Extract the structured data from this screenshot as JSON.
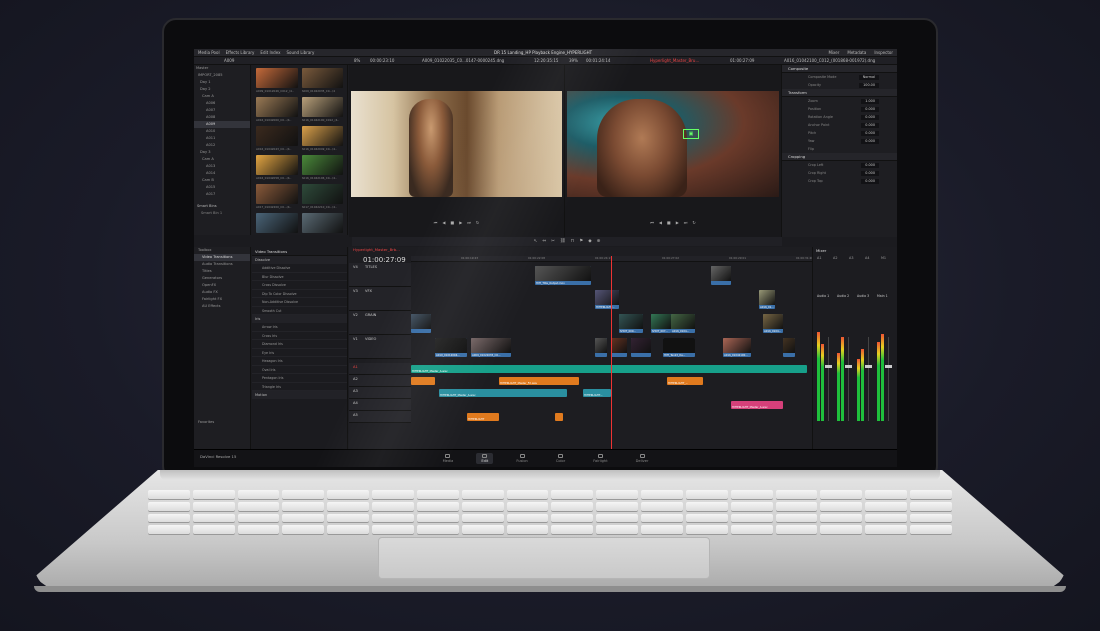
{
  "app": {
    "title": "DR 15 Landing_HP Playback Engine_HYPERLIGHT",
    "brand": "DaVinci Resolve 15"
  },
  "topbar": {
    "left": [
      "Media Pool",
      "Effects Library",
      "Edit Index",
      "Sound Library"
    ],
    "right": [
      "Mixer",
      "Metadata",
      "Inspector"
    ]
  },
  "row2": {
    "bin": "A009",
    "zoom_left": "8%",
    "tc_left": "00:00:23:10",
    "clip_left": "A009_01022035_C0...0147-0000245.dng",
    "tc_center": "12:20:35:15",
    "zoom_right": "39%",
    "tc_right": "00:01:24:14",
    "clip_right": "Hyperlight_Master_Bru...",
    "tc_right2": "01:00:27:09",
    "clip_insp": "A016_01042100_C012_(001868-001972).dng"
  },
  "media_tree": [
    {
      "label": "Master",
      "sel": false
    },
    {
      "label": "IMPORT_2085",
      "sel": false
    },
    {
      "label": "Day 1",
      "sel": false
    },
    {
      "label": "Day 2",
      "sel": false
    },
    {
      "label": "Cam A",
      "sel": false
    },
    {
      "label": "A006",
      "sel": false
    },
    {
      "label": "A007",
      "sel": false
    },
    {
      "label": "A008",
      "sel": false
    },
    {
      "label": "A009",
      "sel": true
    },
    {
      "label": "A010",
      "sel": false
    },
    {
      "label": "A011",
      "sel": false
    },
    {
      "label": "A012",
      "sel": false
    },
    {
      "label": "Day 3",
      "sel": false
    },
    {
      "label": "Cam A",
      "sel": false
    },
    {
      "label": "A013",
      "sel": false
    },
    {
      "label": "A014",
      "sel": false
    },
    {
      "label": "Cam B",
      "sel": false
    },
    {
      "label": "A015",
      "sel": false
    },
    {
      "label": "A017",
      "sel": false
    }
  ],
  "smart_bins": {
    "heading": "Smart Bins",
    "item": "Smart Bin 1"
  },
  "thumbs": [
    {
      "cap": "A009_01012046_C012_(4..",
      "color": "#c56a3a"
    },
    {
      "cap": "A009_01022035_C0...(4",
      "color": "#7a5a3c"
    },
    {
      "cap": "A016_01042000_C0...(4..",
      "color": "#9a7a55"
    },
    {
      "cap": "A016_01042100_C012_(4..",
      "color": "#b8a07a"
    },
    {
      "cap": "A016_01042043_C0...(4..",
      "color": "#3b2a1e"
    },
    {
      "cap": "A016_01042049_C0...(4..",
      "color": "#d9a04a"
    },
    {
      "cap": "A016_01042058_C0...(4..",
      "color": "#e2a542"
    },
    {
      "cap": "A016_01042106_C0...(4..",
      "color": "#4a8a3a"
    },
    {
      "cap": "A017_01042200_C0...(4..",
      "color": "#8a5a3a"
    },
    {
      "cap": "A017_01042210_C0...(4..",
      "color": "#2e4a3a"
    },
    {
      "cap": "",
      "color": "#4a6478"
    },
    {
      "cap": "",
      "color": "#5a6a74"
    }
  ],
  "inspector": {
    "sections": [
      {
        "heading": "Composite",
        "rows": [
          [
            "Composite Mode",
            "Normal"
          ],
          [
            "Opacity",
            "100.00"
          ]
        ]
      },
      {
        "heading": "Transform",
        "rows": [
          [
            "Zoom",
            "1.000"
          ],
          [
            "Position",
            "0.000"
          ],
          [
            "Rotation Angle",
            "0.000"
          ],
          [
            "Anchor Point",
            "0.000"
          ],
          [
            "Pitch",
            "0.000"
          ],
          [
            "Yaw",
            "0.000"
          ],
          [
            "Flip",
            ""
          ]
        ]
      },
      {
        "heading": "Cropping",
        "rows": [
          [
            "Crop Left",
            "0.000"
          ],
          [
            "Crop Right",
            "0.000"
          ],
          [
            "Crop Top",
            "0.000"
          ]
        ]
      }
    ]
  },
  "effects_tree": [
    "Toolbox",
    "Video Transitions",
    "Audio Transitions",
    "Titles",
    "Generators",
    "OpenFX",
    "Audio FX",
    "Fairlight FX",
    "AU Effects"
  ],
  "effects_tree_footer": "Favorites",
  "effects_list": {
    "heading": "Video Transitions",
    "groups": [
      {
        "name": "Dissolve",
        "items": [
          "Additive Dissolve",
          "Blur Dissolve",
          "Cross Dissolve",
          "Dip To Color Dissolve",
          "Non-Additive Dissolve",
          "Smooth Cut"
        ]
      },
      {
        "name": "Iris",
        "items": [
          "Arrow Iris",
          "Cross Iris",
          "Diamond Iris",
          "Eye Iris",
          "Hexagon Iris",
          "Oval Iris",
          "Pentagon Iris",
          "Triangle Iris"
        ]
      },
      {
        "name": "Motion",
        "items": []
      }
    ]
  },
  "timeline": {
    "tab": "Hyperlight_Master_Brb...",
    "timecode": "01:00:27:09",
    "ruler": [
      "01:00:19:23",
      "01:00:22:08",
      "01:00:24:17",
      "01:00:27:02",
      "01:00:29:01",
      "01:00:31:26"
    ],
    "video_tracks": [
      {
        "id": "V4",
        "name": "TITLES"
      },
      {
        "id": "V3",
        "name": "VFX"
      },
      {
        "id": "V2",
        "name": "GRAIN"
      },
      {
        "id": "V1",
        "name": "VIDEO"
      }
    ],
    "audio_tracks": [
      "A1",
      "A2",
      "A3",
      "A4",
      "A5"
    ],
    "clips": [
      {
        "track": "V4",
        "start": 0.31,
        "len": 0.14,
        "label": "HYP_Title_Output.mov",
        "cls": "v",
        "img": "#555"
      },
      {
        "track": "V4",
        "start": 0.75,
        "len": 0.05,
        "label": "",
        "cls": "v",
        "img": "#666"
      },
      {
        "track": "V3",
        "start": 0.46,
        "len": 0.06,
        "label": "HYPERLIGHT...",
        "cls": "v",
        "img": "#557"
      },
      {
        "track": "V3",
        "start": 0.87,
        "len": 0.04,
        "label": "A016_01...",
        "cls": "v",
        "img": "#997"
      },
      {
        "track": "V2",
        "start": 0.0,
        "len": 0.05,
        "label": "",
        "cls": "v",
        "img": "#456"
      },
      {
        "track": "V2",
        "start": 0.52,
        "len": 0.06,
        "label": "SHOT_009...",
        "cls": "v",
        "img": "#355"
      },
      {
        "track": "V2",
        "start": 0.6,
        "len": 0.05,
        "label": "SHOT_007...",
        "cls": "v",
        "img": "#375"
      },
      {
        "track": "V2",
        "start": 0.65,
        "len": 0.06,
        "label": "A016_0104...",
        "cls": "v",
        "img": "#464"
      },
      {
        "track": "V2",
        "start": 0.88,
        "len": 0.05,
        "label": "A016_0104...",
        "cls": "v",
        "img": "#764"
      },
      {
        "track": "V1",
        "start": 0.06,
        "len": 0.08,
        "label": "A010_01012046...",
        "cls": "v",
        "img": "#222"
      },
      {
        "track": "V1",
        "start": 0.15,
        "len": 0.1,
        "label": "A009_01022035_C0...",
        "cls": "v",
        "img": "#766"
      },
      {
        "track": "V1",
        "start": 0.46,
        "len": 0.03,
        "label": "",
        "cls": "v",
        "img": "#555"
      },
      {
        "track": "V1",
        "start": 0.5,
        "len": 0.04,
        "label": "",
        "cls": "v",
        "img": "#632"
      },
      {
        "track": "V1",
        "start": 0.55,
        "len": 0.05,
        "label": "",
        "cls": "v",
        "img": "#323"
      },
      {
        "track": "V1",
        "start": 0.63,
        "len": 0.08,
        "label": "HYP_Tank3_De...",
        "cls": "v",
        "img": "#111"
      },
      {
        "track": "V1",
        "start": 0.78,
        "len": 0.07,
        "label": "A016_01042100...",
        "cls": "v",
        "img": "#a65"
      },
      {
        "track": "V1",
        "start": 0.93,
        "len": 0.03,
        "label": "",
        "cls": "v",
        "img": "#432"
      },
      {
        "track": "A1",
        "start": 0.0,
        "len": 0.99,
        "label": "HYPERLIGHT_Master_A.wav",
        "cls": "a1"
      },
      {
        "track": "A2",
        "start": 0.0,
        "len": 0.06,
        "label": "",
        "cls": "a2"
      },
      {
        "track": "A2",
        "start": 0.22,
        "len": 0.2,
        "label": "HYPERLIGHT_Master_FX.wav",
        "cls": "a2"
      },
      {
        "track": "A2",
        "start": 0.64,
        "len": 0.09,
        "label": "HYPERLIGHT_...",
        "cls": "a2"
      },
      {
        "track": "A3",
        "start": 0.07,
        "len": 0.32,
        "label": "HYPERLIGHT_Master_A.wav",
        "cls": "a3"
      },
      {
        "track": "A3",
        "start": 0.43,
        "len": 0.07,
        "label": "HYPERLIGHT...",
        "cls": "a3"
      },
      {
        "track": "A4",
        "start": 0.8,
        "len": 0.13,
        "label": "HYPERLIGHT_Master_A.wav",
        "cls": "a4"
      },
      {
        "track": "A5",
        "start": 0.14,
        "len": 0.08,
        "label": "HYPERLIGHT",
        "cls": "a2"
      },
      {
        "track": "A5",
        "start": 0.36,
        "len": 0.02,
        "label": "",
        "cls": "a2"
      }
    ]
  },
  "mixer": {
    "heading": "Mixer",
    "channels": [
      "A1",
      "A2",
      "A3",
      "A4",
      "M1"
    ],
    "buses": [
      "Audio 1",
      "Audio 2",
      "Audio 3",
      "Main 1"
    ],
    "levels": [
      0.72,
      0.62,
      0.55,
      0.68,
      0.5,
      0.58,
      0.64,
      0.7
    ]
  },
  "pages": [
    {
      "label": "Media",
      "active": false
    },
    {
      "label": "Edit",
      "active": true
    },
    {
      "label": "Fusion",
      "active": false
    },
    {
      "label": "Color",
      "active": false
    },
    {
      "label": "Fairlight",
      "active": false
    },
    {
      "label": "Deliver",
      "active": false
    }
  ]
}
